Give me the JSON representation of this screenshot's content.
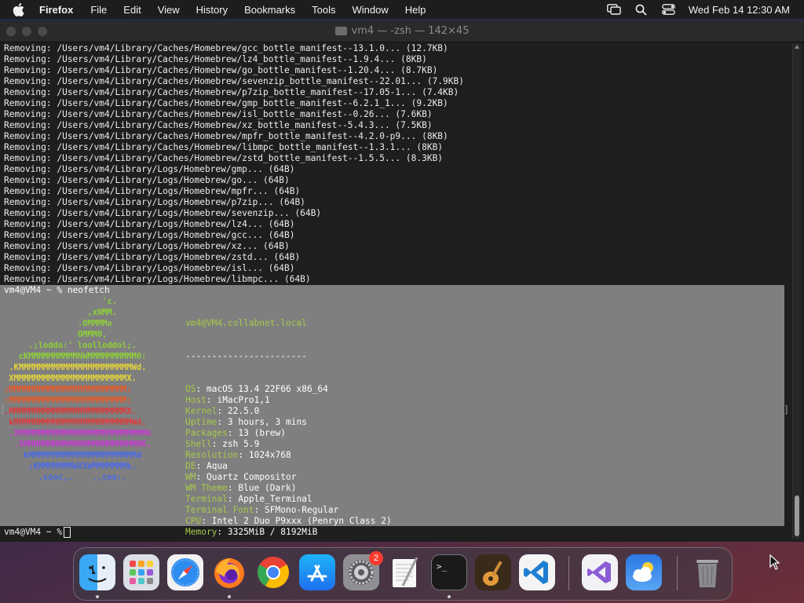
{
  "menubar": {
    "app_name": "Firefox",
    "menus": [
      "File",
      "Edit",
      "View",
      "History",
      "Bookmarks",
      "Tools",
      "Window",
      "Help"
    ],
    "clock": "Wed Feb 14  12:30 AM",
    "icons": [
      "apple-icon",
      "screen-mirror-icon",
      "search-icon",
      "control-center-icon"
    ]
  },
  "terminal": {
    "title": "vm4 — -zsh — 142×45",
    "output_lines": [
      "Removing: /Users/vm4/Library/Caches/Homebrew/gcc_bottle_manifest--13.1.0... (12.7KB)",
      "Removing: /Users/vm4/Library/Caches/Homebrew/lz4_bottle_manifest--1.9.4... (8KB)",
      "Removing: /Users/vm4/Library/Caches/Homebrew/go_bottle_manifest--1.20.4... (8.7KB)",
      "Removing: /Users/vm4/Library/Caches/Homebrew/sevenzip_bottle_manifest--22.01... (7.9KB)",
      "Removing: /Users/vm4/Library/Caches/Homebrew/p7zip_bottle_manifest--17.05-1... (7.4KB)",
      "Removing: /Users/vm4/Library/Caches/Homebrew/gmp_bottle_manifest--6.2.1_1... (9.2KB)",
      "Removing: /Users/vm4/Library/Caches/Homebrew/isl_bottle_manifest--0.26... (7.6KB)",
      "Removing: /Users/vm4/Library/Caches/Homebrew/xz_bottle_manifest--5.4.3... (7.5KB)",
      "Removing: /Users/vm4/Library/Caches/Homebrew/mpfr_bottle_manifest--4.2.0-p9... (8KB)",
      "Removing: /Users/vm4/Library/Caches/Homebrew/libmpc_bottle_manifest--1.3.1... (8KB)",
      "Removing: /Users/vm4/Library/Caches/Homebrew/zstd_bottle_manifest--1.5.5... (8.3KB)",
      "Removing: /Users/vm4/Library/Logs/Homebrew/gmp... (64B)",
      "Removing: /Users/vm4/Library/Logs/Homebrew/go... (64B)",
      "Removing: /Users/vm4/Library/Logs/Homebrew/mpfr... (64B)",
      "Removing: /Users/vm4/Library/Logs/Homebrew/p7zip... (64B)",
      "Removing: /Users/vm4/Library/Logs/Homebrew/sevenzip... (64B)",
      "Removing: /Users/vm4/Library/Logs/Homebrew/lz4... (64B)",
      "Removing: /Users/vm4/Library/Logs/Homebrew/gcc... (64B)",
      "Removing: /Users/vm4/Library/Logs/Homebrew/xz... (64B)",
      "Removing: /Users/vm4/Library/Logs/Homebrew/zstd... (64B)",
      "Removing: /Users/vm4/Library/Logs/Homebrew/isl... (64B)",
      "Removing: /Users/vm4/Library/Logs/Homebrew/libmpc... (64B)"
    ],
    "command_prompt": "vm4@VM4 ~ % neofetch",
    "neofetch": {
      "user_host": "vm4@VM4.collabnet.local",
      "separator": "-----------------------",
      "logo_lines": [
        {
          "text": "                    'c.",
          "color": "#8fd13a"
        },
        {
          "text": "                 ,xNMM.",
          "color": "#8fd13a"
        },
        {
          "text": "               .OMMMMo",
          "color": "#8fd13a"
        },
        {
          "text": "               OMMM0,",
          "color": "#8fd13a"
        },
        {
          "text": "     .;loddo:' loolloddol;.",
          "color": "#8fd13a"
        },
        {
          "text": "   cKMMMMMMMMMMNWMMMMMMMMMM0:",
          "color": "#8fd13a"
        },
        {
          "text": " .KMMMMMMMMMMMMMMMMMMMMMMMWd.",
          "color": "#e5d63a"
        },
        {
          "text": " XMMMMMMMMMMMMMMMMMMMMMMMX.",
          "color": "#e5d63a"
        },
        {
          "text": ";MMMMMMMMMMMMMMMMMMMMMMMM:",
          "color": "#e85a2a"
        },
        {
          "text": ":MMMMMMMMMMMMMMMMMMMMMMMM:",
          "color": "#e85a2a"
        },
        {
          "text": ".MMMMMMMMMMMMMMMMMMMMMMMMX.",
          "color": "#e03a3a"
        },
        {
          "text": " kMMMMMMMMMMMMMMMMMMMMMMMMWd.",
          "color": "#e03a3a"
        },
        {
          "text": " .XMMMMMMMMMMMMMMMMMMMMMMMMMMk",
          "color": "#c63ad1"
        },
        {
          "text": "  .XMMMMMMMMMMMMMMMMMMMMMMMMK.",
          "color": "#c63ad1"
        },
        {
          "text": "    kMMMMMMMMMMMMMMMMMMMMMMd",
          "color": "#4a6be8"
        },
        {
          "text": "     ;KMMMMMMMWXXWMMMMMMMk.",
          "color": "#4a6be8"
        },
        {
          "text": "       .cooc,.    .,coo:.",
          "color": "#4a6be8"
        }
      ],
      "info": [
        {
          "key": "OS",
          "value": "macOS 13.4 22F66 x86_64"
        },
        {
          "key": "Host",
          "value": "iMacPro1,1"
        },
        {
          "key": "Kernel",
          "value": "22.5.0"
        },
        {
          "key": "Uptime",
          "value": "3 hours, 3 mins"
        },
        {
          "key": "Packages",
          "value": "13 (brew)"
        },
        {
          "key": "Shell",
          "value": "zsh 5.9"
        },
        {
          "key": "Resolution",
          "value": "1024x768"
        },
        {
          "key": "DE",
          "value": "Aqua"
        },
        {
          "key": "WM",
          "value": "Quartz Compositor"
        },
        {
          "key": "WM Theme",
          "value": "Blue (Dark)"
        },
        {
          "key": "Terminal",
          "value": "Apple_Terminal"
        },
        {
          "key": "Terminal Font",
          "value": "SFMono-Regular"
        },
        {
          "key": "CPU",
          "value": "Intel 2 Duo P9xxx (Penryn Class 2)"
        },
        {
          "key": "Memory",
          "value": "3325MiB / 8192MiB"
        }
      ]
    },
    "current_prompt": "vm4@VM4 ~ %"
  },
  "dock": {
    "apps": [
      {
        "name": "Finder",
        "icon": "finder-icon",
        "running": true
      },
      {
        "name": "Launchpad",
        "icon": "launchpad-icon",
        "running": false
      },
      {
        "name": "Safari",
        "icon": "safari-icon",
        "running": false
      },
      {
        "name": "Firefox",
        "icon": "firefox-icon",
        "running": true
      },
      {
        "name": "Google Chrome",
        "icon": "chrome-icon",
        "running": false
      },
      {
        "name": "App Store",
        "icon": "app-store-icon",
        "running": false
      },
      {
        "name": "System Settings",
        "icon": "system-settings-icon",
        "running": false,
        "badge": "2"
      },
      {
        "name": "TextEdit",
        "icon": "textedit-icon",
        "running": false
      },
      {
        "name": "Terminal",
        "icon": "terminal-icon",
        "running": true
      },
      {
        "name": "GarageBand",
        "icon": "garageband-icon",
        "running": false
      },
      {
        "name": "Visual Studio Code",
        "icon": "vscode-icon",
        "running": false
      },
      {
        "name": "Visual Studio",
        "icon": "visual-studio-icon",
        "running": false
      },
      {
        "name": "Weather",
        "icon": "weather-icon",
        "running": false
      },
      {
        "name": "Trash",
        "icon": "trash-icon",
        "running": false
      }
    ]
  }
}
